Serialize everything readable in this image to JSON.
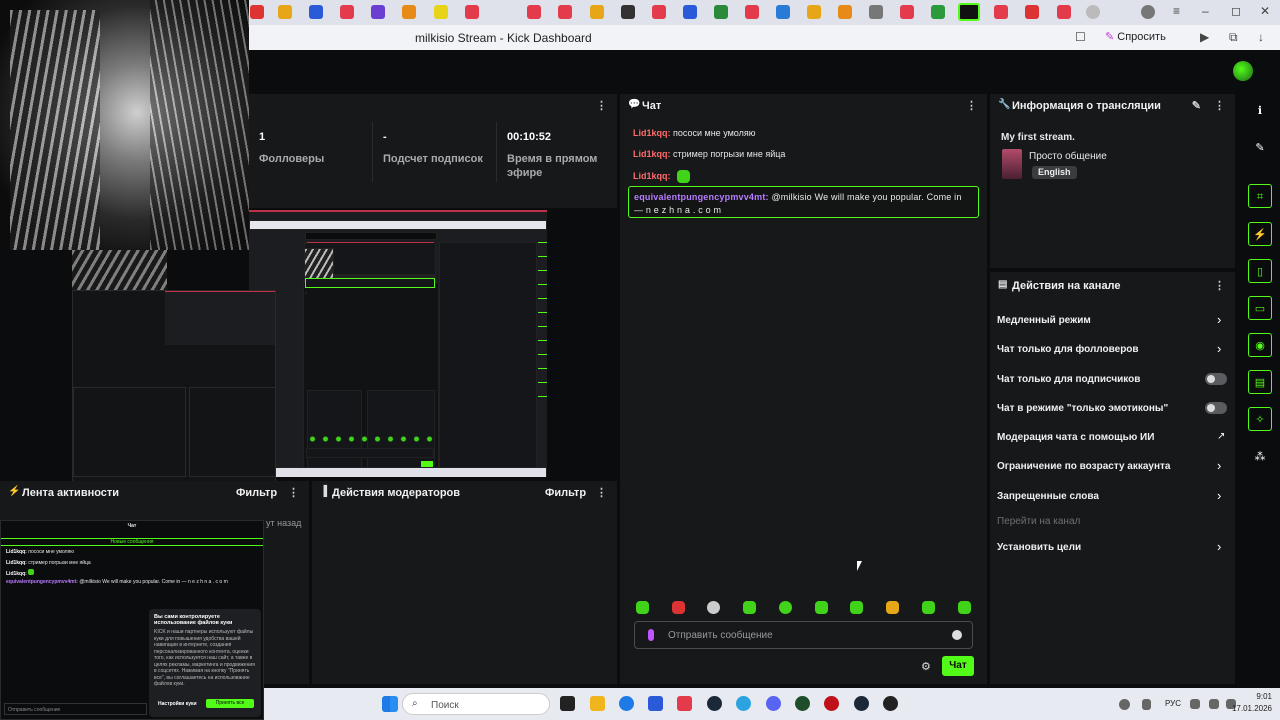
{
  "browser": {
    "page_title": "milkisio Stream - Kick Dashboard",
    "ask_label": "Спросить"
  },
  "stats": {
    "followers_value": "1",
    "followers_label": "Фолловеры",
    "subs_value": "-",
    "subs_label": "Подсчет подписок",
    "live_value": "00:10:52",
    "live_label_1": "Время в прямом",
    "live_label_2": "эфире"
  },
  "chat": {
    "title": "Чат",
    "messages": [
      {
        "user": "Lid1kqq:",
        "text": "пососи мне умоляю"
      },
      {
        "user": "Lid1kqq:",
        "text": "стример погрызи мне яйца"
      },
      {
        "user": "Lid1kqq:",
        "text": ""
      }
    ],
    "highlight": {
      "user": "equivalentpungencypmvv4mt:",
      "text": "@milkisio We will make you popular. Come in — n e z h n a . c o m"
    },
    "input_placeholder": "Отправить сообщение",
    "send_label": "Чат"
  },
  "stream_info": {
    "title": "Информация о трансляции",
    "stream_title": "My first stream.",
    "category": "Просто общение",
    "language": "English"
  },
  "channel_actions": {
    "title": "Действия на канале",
    "items": [
      {
        "label": "Медленный режим",
        "control": "arrow"
      },
      {
        "label": "Чат только для фолловеров",
        "control": "arrow"
      },
      {
        "label": "Чат только для подписчиков",
        "control": "toggle"
      },
      {
        "label": "Чат в режиме \"только эмотиконы\"",
        "control": "toggle"
      },
      {
        "label": "Модерация чата с помощью ИИ",
        "control": "external"
      },
      {
        "label": "Ограничение по возрасту аккаунта",
        "control": "arrow"
      },
      {
        "label": "Запрещенные слова",
        "control": "arrow"
      },
      {
        "label": "Перейти на канал",
        "control": "none"
      },
      {
        "label": "Установить цели",
        "control": "arrow"
      }
    ]
  },
  "activity": {
    "title": "Лента активности",
    "filter": "Фильтр",
    "time_ago": "ут назад"
  },
  "moderators": {
    "title": "Действия модераторов",
    "filter": "Фильтр"
  },
  "overlay": {
    "chat_title": "Чат",
    "new_messages": "Новые сообщения",
    "lines": [
      {
        "user": "Lid1kqq:",
        "text": "пососи мне умоляю"
      },
      {
        "user": "Lid1kqq:",
        "text": "стример погрызи мне яйца"
      },
      {
        "user": "Lid1kqq:",
        "text": ""
      },
      {
        "user": "equivalentpungencypmvv4mt:",
        "text": "@milkisio We will make you popular. Come in — n e z h n a . c o m"
      }
    ],
    "cookie_title": "Вы сами контролируете использование файлов куки",
    "cookie_text": "KICK и наши партнеры используют файлы куки для повышения удобства вашей навигации в интернете, создания персонализированного контента, оценки того, как используется наш сайт, а также в целях рекламы, маркетинга и продвижения в соцсетях. Нажимая на кнопку \"Принять все\", вы соглашаетесь на использование файлов куки.",
    "cookie_settings": "Настройки куки",
    "cookie_accept": "Принять все",
    "input_placeholder": "Отправить сообщение"
  },
  "taskbar": {
    "search": "Поиск",
    "lang": "РУС",
    "time": "9:01",
    "date": "17.01.2026"
  },
  "colors": {
    "accent": "#53fc18",
    "username": "#ff6b6b",
    "highlight_user": "#b77cff"
  }
}
